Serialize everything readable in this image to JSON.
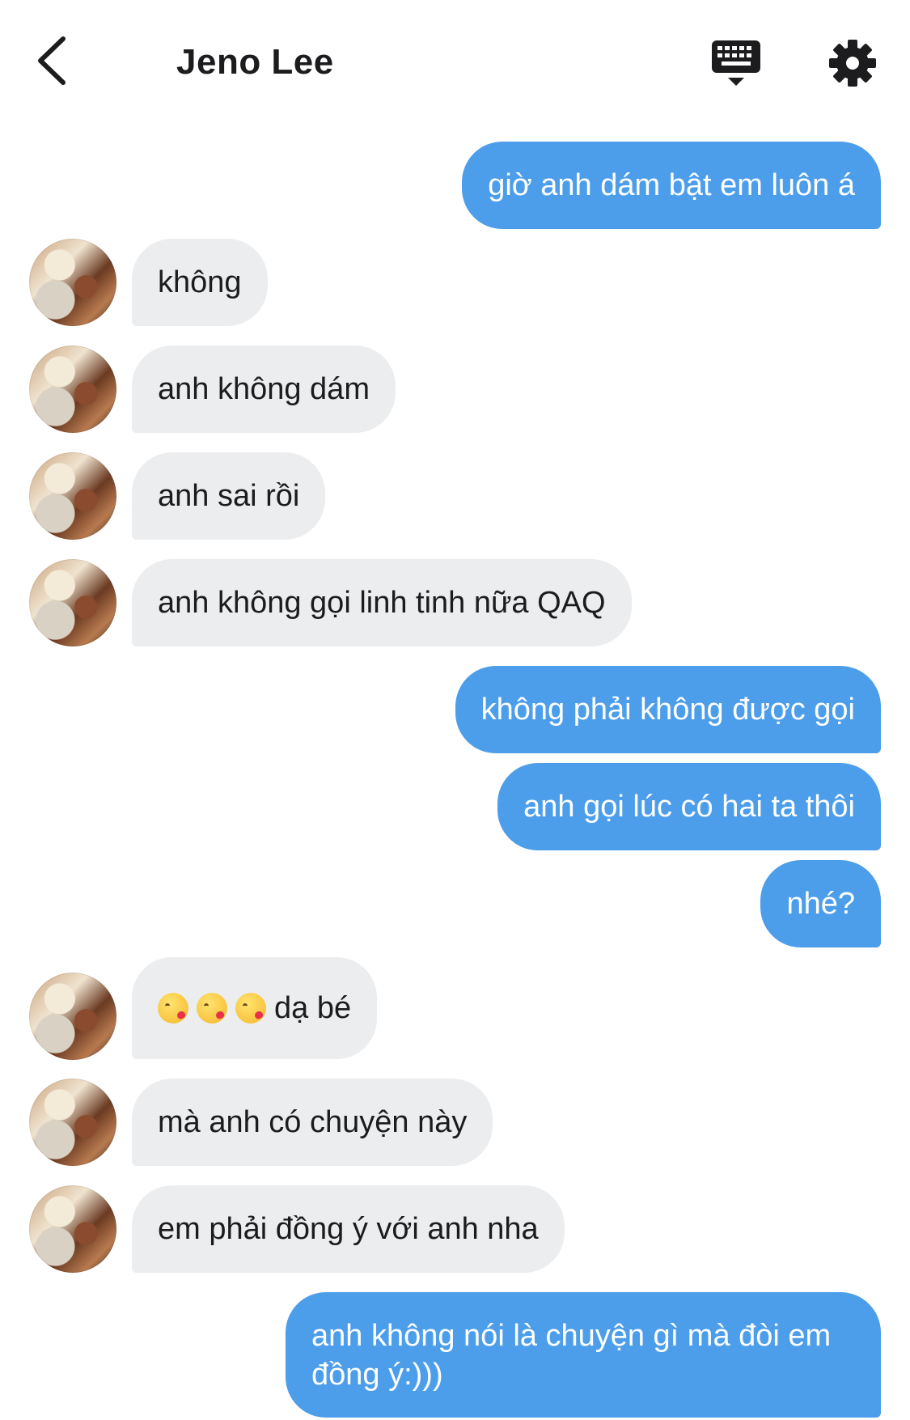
{
  "header": {
    "contact_name": "Jeno Lee",
    "back_icon": "chevron-left-icon",
    "keyboard_icon": "keyboard-icon",
    "settings_icon": "gear-icon"
  },
  "colors": {
    "sent_bubble": "#4d9eea",
    "received_bubble": "#ecedef",
    "text_dark": "#1c1c1e"
  },
  "messages": [
    {
      "direction": "sent",
      "text": "giờ anh dám bật em luôn á"
    },
    {
      "direction": "received",
      "text": "không"
    },
    {
      "direction": "received",
      "text": "anh không dám"
    },
    {
      "direction": "received",
      "text": "anh sai rồi"
    },
    {
      "direction": "received",
      "text": "anh không gọi linh tinh nữa QAQ"
    },
    {
      "direction": "sent",
      "text": "không phải không được gọi"
    },
    {
      "direction": "sent",
      "text": "anh gọi lúc có hai ta thôi"
    },
    {
      "direction": "sent",
      "text": "nhé?"
    },
    {
      "direction": "received",
      "emoji": "😘😘😘",
      "text": "dạ bé"
    },
    {
      "direction": "received",
      "text": "mà anh có chuyện này"
    },
    {
      "direction": "received",
      "text": "em phải đồng ý với anh nha"
    },
    {
      "direction": "sent",
      "text": "anh không nói là chuyện gì mà đòi em đồng ý:)))"
    }
  ]
}
